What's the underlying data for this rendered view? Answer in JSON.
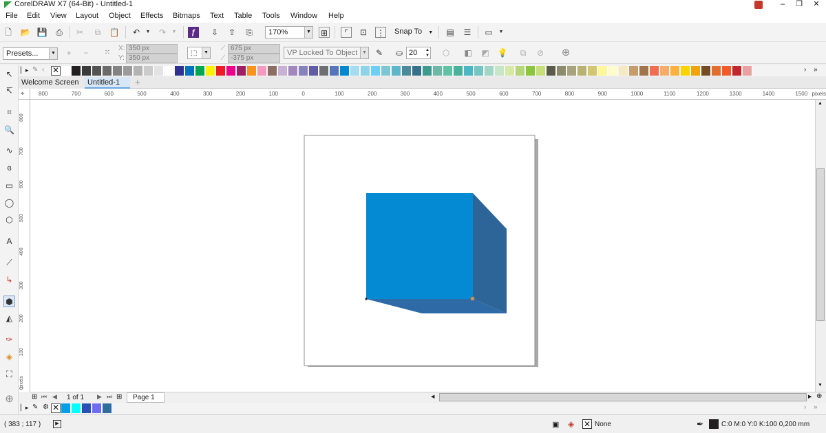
{
  "window": {
    "title": "CorelDRAW X7 (64-Bit) - Untitled-1",
    "controls": [
      "‒",
      "❐",
      "✕"
    ]
  },
  "menu": [
    "File",
    "Edit",
    "View",
    "Layout",
    "Object",
    "Effects",
    "Bitmaps",
    "Text",
    "Table",
    "Tools",
    "Window",
    "Help"
  ],
  "toolbar": {
    "zoom_value": "170%",
    "snap_to_label": "Snap To"
  },
  "propbar": {
    "presets_label": "Presets...",
    "x_label": "X:",
    "x_value": "350 px",
    "y_label": "Y:",
    "y_value": "350 px",
    "vp_x_value": "675 px",
    "vp_y_value": "-375 px",
    "vp_mode": "VP Locked To Object",
    "depth_value": "20"
  },
  "palette_colors": [
    "#ffffff",
    "#231f20",
    "#3b3b3b",
    "#535353",
    "#6b6b6b",
    "#838383",
    "#9b9b9b",
    "#b3b3b3",
    "#cbcbcb",
    "#e3e3e3",
    "#ffffff",
    "#2e3192",
    "#0072bc",
    "#00a651",
    "#fff200",
    "#ed1c24",
    "#ec008c",
    "#9e1f63",
    "#f7941d",
    "#f49ac1",
    "#8c6d62",
    "#c7b2d6",
    "#a187be",
    "#8781bd",
    "#605ca8",
    "#6d6e71",
    "#5674b9",
    "#0088d1",
    "#a6dcf1",
    "#8fd3e8",
    "#6dcff6",
    "#7dc7d4",
    "#5fb6c9",
    "#4a8a9a",
    "#36708a",
    "#3e9a8e",
    "#6fb8a5",
    "#5ec4a4",
    "#46b39a",
    "#4bb7c4",
    "#75c6c3",
    "#a2d5c6",
    "#c7e6c8",
    "#d6e9a6",
    "#b5d67a",
    "#8cc63f",
    "#c6df78",
    "#5b5b4a",
    "#8c8c6c",
    "#a6a37e",
    "#b9b373",
    "#d2c770",
    "#fff799",
    "#fffbcc",
    "#f7e9c4",
    "#c69c6d",
    "#a0754b",
    "#f26c4f",
    "#f7ad6a",
    "#fbb040",
    "#fbd400",
    "#f0a30a",
    "#754c24",
    "#e06c2e",
    "#f15a29",
    "#c1272d",
    "#e8a2a2"
  ],
  "tabs": [
    "Welcome Screen",
    "Untitled-1"
  ],
  "ruler": {
    "h_ticks": [
      "800",
      "700",
      "600",
      "500",
      "400",
      "300",
      "200",
      "100",
      "0",
      "100",
      "200",
      "300",
      "400",
      "500",
      "600",
      "700",
      "800",
      "900",
      "1000",
      "1100",
      "1200",
      "1300",
      "1400",
      "1500"
    ],
    "h_units": "pixels",
    "v_ticks": [
      "800",
      "700",
      "600",
      "500",
      "400",
      "300",
      "200",
      "100",
      "0"
    ],
    "v_units": "pixels"
  },
  "page_nav": {
    "counter": "1 of 1",
    "page_tab": "Page 1"
  },
  "doc_palette_colors": [
    "#00a0e9",
    "#00ffff",
    "#2b50b5",
    "#6f6cf2",
    "#2f6c9e"
  ],
  "status": {
    "coords": "( 383  ; 117   )",
    "fill_label": "None",
    "outline_label": "C:0 M:0 Y:0 K:100  0,200 mm"
  },
  "colors": {
    "cube_front": "#0489d3",
    "cube_side": "#2e6598",
    "cube_bottom": "#2d6aa6"
  }
}
